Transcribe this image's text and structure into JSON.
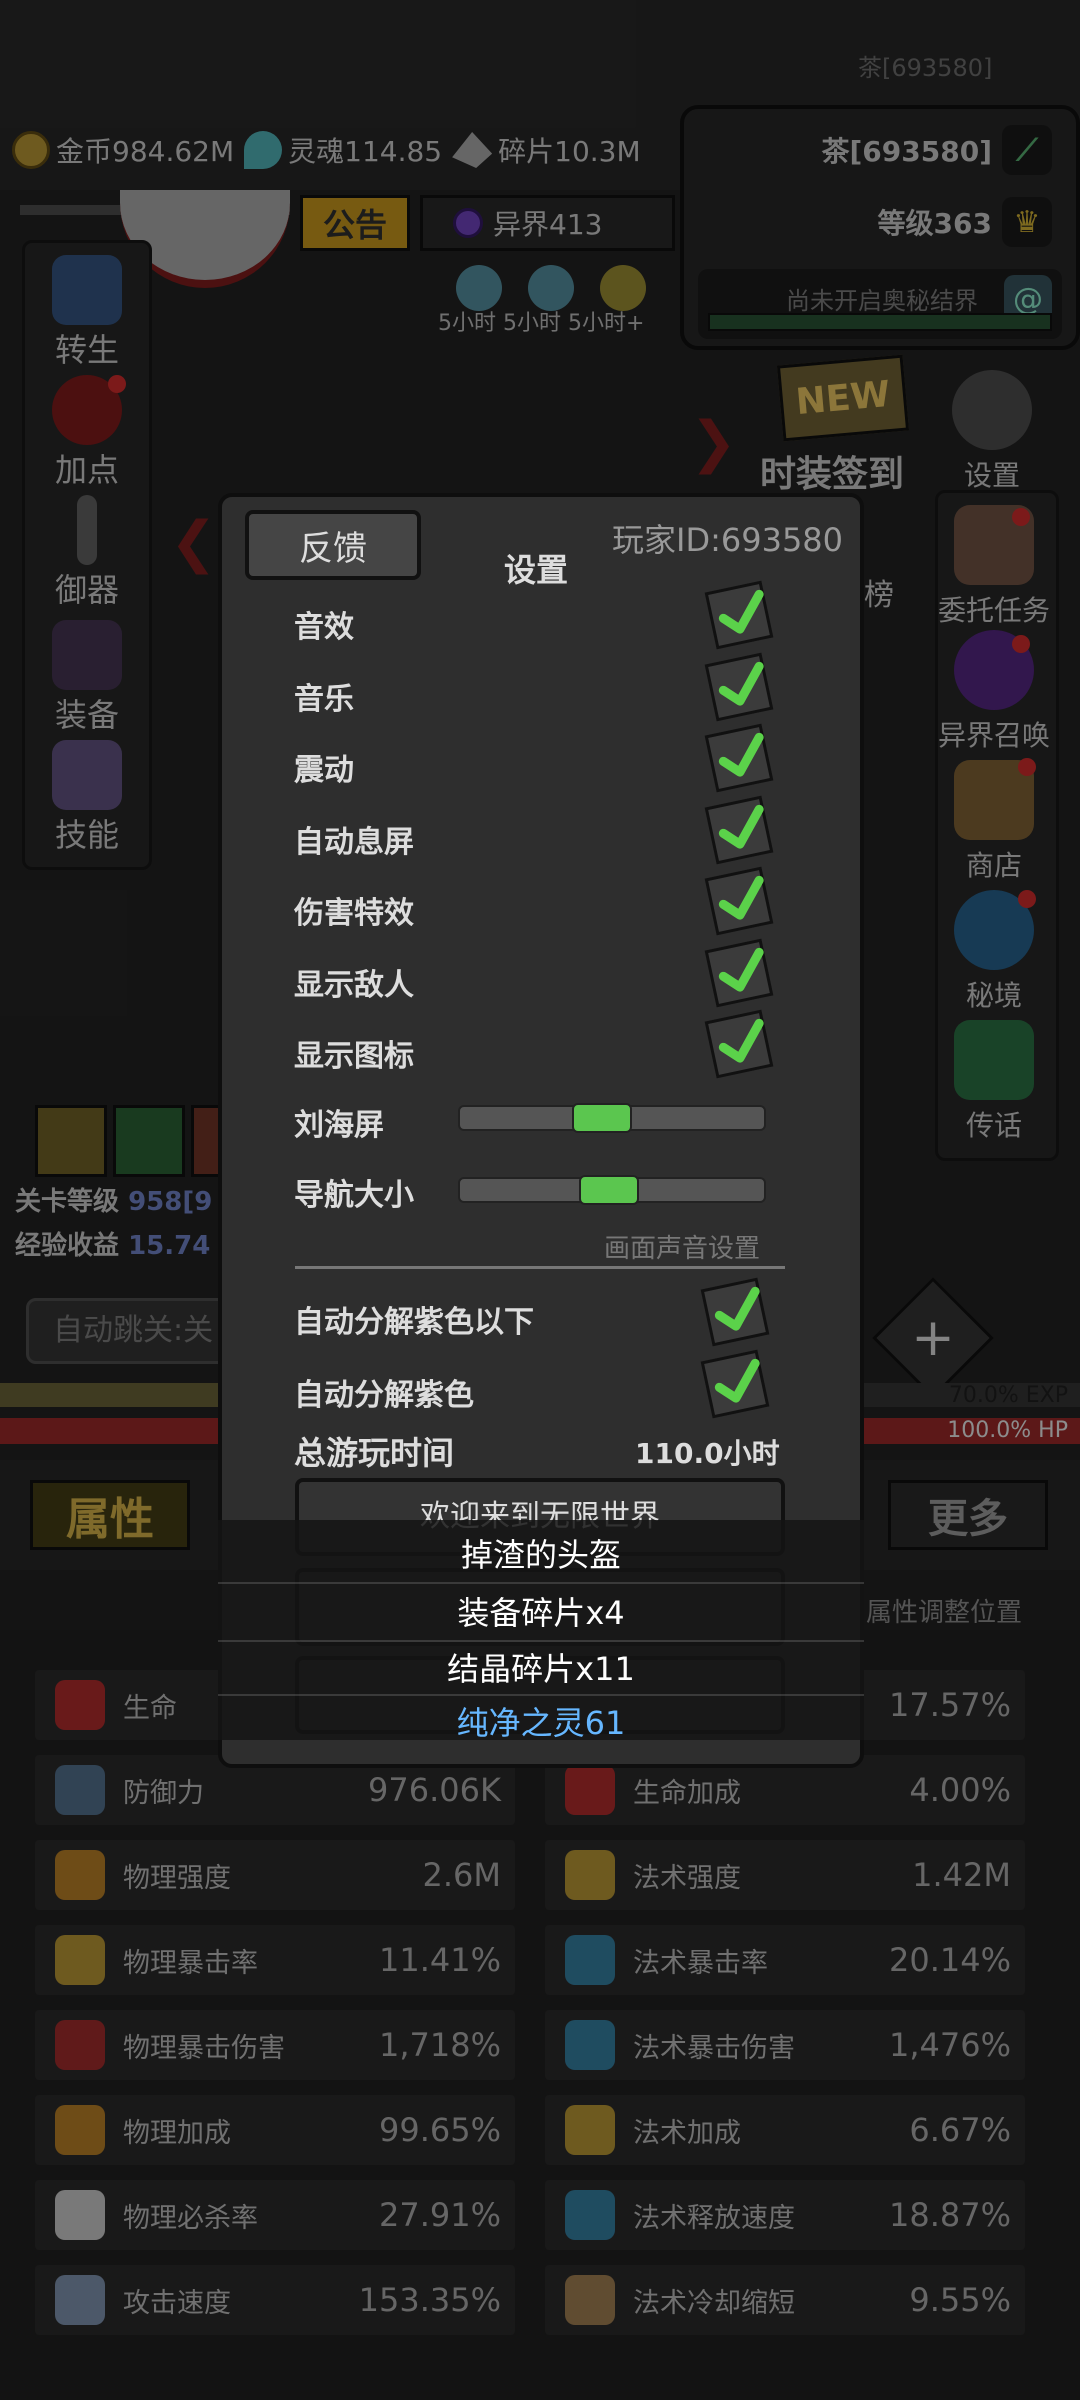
{
  "system": {
    "id_text": "茶[693580]"
  },
  "currency": {
    "gold": "金币984.62M",
    "soul": "灵魂114.85",
    "fragment": "碎片10.3M"
  },
  "player": {
    "name": "茶[693580]",
    "level": "等级363",
    "realm": "尚未开启奥秘结界"
  },
  "top": {
    "notice": "公告",
    "otherworld": "异界413",
    "timers": "5小时 5小时 5小时+"
  },
  "left_menu": [
    "转生",
    "加点",
    "御器",
    "装备",
    "技能"
  ],
  "right_menu": {
    "event": "时装签到",
    "settings": "设置",
    "rank_partial": "榜",
    "items": [
      "委托任务",
      "异界召唤",
      "商店",
      "秘境",
      "传话"
    ]
  },
  "stage": {
    "level_label": "关卡等级",
    "level_value": "958[9",
    "exp_label": "经验收益",
    "exp_value": "15.74",
    "autojump": "自动跳关:关"
  },
  "bars": {
    "exp": "70.0% EXP",
    "exp_fraction": 0.7,
    "hp": "100.0% HP",
    "hp_fraction": 1.0
  },
  "tabs": {
    "attr": "属性",
    "more": "更多",
    "adjust": "属性调整位置"
  },
  "stats": [
    {
      "name": "生命",
      "value": "",
      "icon": "heart-icon"
    },
    {
      "name": "",
      "value": "17.57%",
      "icon": ""
    },
    {
      "name": "防御力",
      "value": "976.06K",
      "icon": "shield-icon"
    },
    {
      "name": "生命加成",
      "value": "4.00%",
      "icon": "heart-plus-icon"
    },
    {
      "name": "物理强度",
      "value": "2.6M",
      "icon": "sword-icon"
    },
    {
      "name": "法术强度",
      "value": "1.42M",
      "icon": "crescent-icon"
    },
    {
      "name": "物理暴击率",
      "value": "11.41%",
      "icon": "crit-icon"
    },
    {
      "name": "法术暴击率",
      "value": "20.14%",
      "icon": "magic-crit-icon"
    },
    {
      "name": "物理暴击伤害",
      "value": "1,718%",
      "icon": "crit-damage-icon"
    },
    {
      "name": "法术暴击伤害",
      "value": "1,476%",
      "icon": "magic-crit-damage-icon"
    },
    {
      "name": "物理加成",
      "value": "99.65%",
      "icon": "fist-icon"
    },
    {
      "name": "法术加成",
      "value": "6.67%",
      "icon": "magic-bonus-icon"
    },
    {
      "name": "物理必杀率",
      "value": "27.91%",
      "icon": "skull-icon"
    },
    {
      "name": "法术释放速度",
      "value": "18.87%",
      "icon": "mushroom-icon"
    },
    {
      "name": "攻击速度",
      "value": "153.35%",
      "icon": "dagger-icon"
    },
    {
      "name": "法术冷却缩短",
      "value": "9.55%",
      "icon": "hourglass-icon"
    }
  ],
  "dialog": {
    "feedback": "反馈",
    "title": "设置",
    "player_id": "玩家ID:693580",
    "toggles": [
      {
        "label": "音效",
        "checked": true
      },
      {
        "label": "音乐",
        "checked": true
      },
      {
        "label": "震动",
        "checked": true
      },
      {
        "label": "自动息屏",
        "checked": true
      },
      {
        "label": "伤害特效",
        "checked": true
      },
      {
        "label": "显示敌人",
        "checked": true
      },
      {
        "label": "显示图标",
        "checked": true
      }
    ],
    "sliders": [
      {
        "label": "刘海屏",
        "value": 0.45
      },
      {
        "label": "导航大小",
        "value": 0.48
      }
    ],
    "section_caption": "画面声音设置",
    "decompose": [
      {
        "label": "自动分解紫色以下",
        "checked": true
      },
      {
        "label": "自动分解紫色",
        "checked": true
      }
    ],
    "playtime_label": "总游玩时间",
    "playtime_value": "110.0小时",
    "welcome": "欢迎来到无限世界"
  },
  "toast": {
    "lines": [
      "掉渣的头盔",
      "装备碎片x4",
      "结晶碎片x11",
      "纯净之灵61"
    ]
  }
}
